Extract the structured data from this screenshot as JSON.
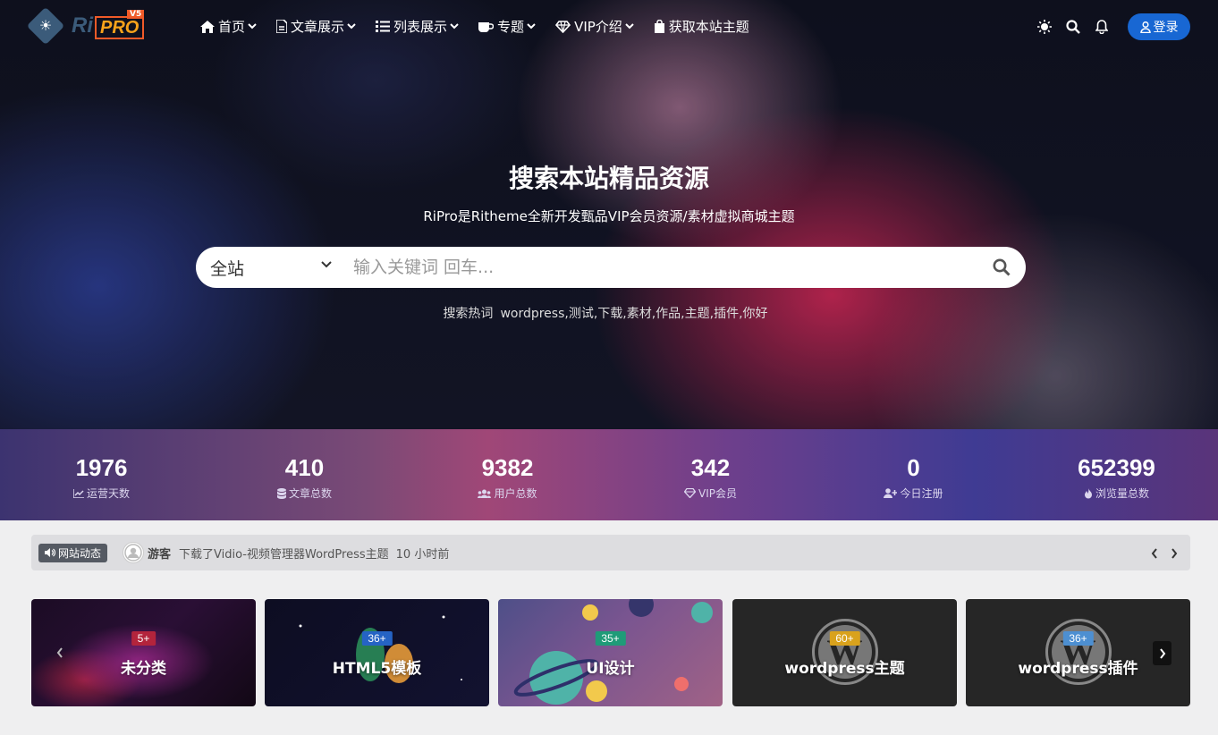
{
  "nav": {
    "logo": {
      "ri": "Ri",
      "pro": "PRO",
      "version": "V5"
    },
    "menu": [
      {
        "label": "首页",
        "icon": "home-icon"
      },
      {
        "label": "文章展示",
        "icon": "document-icon"
      },
      {
        "label": "列表展示",
        "icon": "list-icon"
      },
      {
        "label": "专题",
        "icon": "coffee-icon"
      },
      {
        "label": "VIP介绍",
        "icon": "diamond-icon"
      },
      {
        "label": "获取本站主题",
        "icon": "shopping-bag-icon"
      }
    ],
    "login_label": "登录"
  },
  "hero": {
    "title": "搜索本站精品资源",
    "subtitle": "RiPro是Ritheme全新开发甄品VIP会员资源/素材虚拟商城主题",
    "search": {
      "category": "全站",
      "placeholder": "输入关键词 回车..."
    },
    "hot_label": "搜索热词",
    "hot_words": "wordpress,测试,下载,素材,作品,主题,插件,你好"
  },
  "stats": [
    {
      "value": "1976",
      "label": "运营天数",
      "icon": "chart-icon"
    },
    {
      "value": "410",
      "label": "文章总数",
      "icon": "database-icon"
    },
    {
      "value": "9382",
      "label": "用户总数",
      "icon": "users-icon"
    },
    {
      "value": "342",
      "label": "VIP会员",
      "icon": "diamond-icon"
    },
    {
      "value": "0",
      "label": "今日注册",
      "icon": "user-plus-icon"
    },
    {
      "value": "652399",
      "label": "浏览量总数",
      "icon": "fire-icon"
    }
  ],
  "ticker": {
    "badge": "网站动态",
    "user": "游客",
    "message": "下载了Vidio-视频管理器WordPress主题",
    "time": "10 小时前"
  },
  "categories": [
    {
      "count": "5+",
      "name": "未分类",
      "badge_color": "#b3243c"
    },
    {
      "count": "36+",
      "name": "HTML5模板",
      "badge_color": "#2563c4"
    },
    {
      "count": "35+",
      "name": "UI设计",
      "badge_color": "#1f9b78"
    },
    {
      "count": "60+",
      "name": "wordpress主题",
      "badge_color": "#d9a21c"
    },
    {
      "count": "36+",
      "name": "wordpress插件",
      "badge_color": "#4d8fd1"
    }
  ],
  "colors": {
    "login_button": "#1867d3",
    "logo_pro": "#f7a21b",
    "logo_ri": "#3b5b7a"
  }
}
